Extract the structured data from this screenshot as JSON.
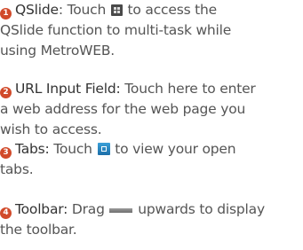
{
  "items": [
    {
      "number": "1",
      "term": "QSlide",
      "sep": ":",
      "text_before_icon": " Touch ",
      "icon": "qslide-icon",
      "line1_after_icon": " to access the",
      "line2": "QSlide function to multi-task while",
      "line3": "using MetroWEB."
    },
    {
      "number": "2",
      "term": "URL Input Field:",
      "line1_text": " Touch here to enter",
      "line2": "a web address for the web page you",
      "line3": "wish to access."
    },
    {
      "number": "3",
      "term": "Tabs:",
      "text_before_icon": " Touch ",
      "icon": "tabs-icon",
      "line1_after_icon": " to view your open",
      "line2": "tabs."
    },
    {
      "number": "4",
      "term": "Toolbar:",
      "text_before_icon": " Drag ",
      "icon": "drag-handle-icon",
      "line1_after_icon": " upwards to display",
      "line2": "the toolbar."
    }
  ],
  "colors": {
    "number_badge": "#d14a2a",
    "body_text": "#555555",
    "term_text": "#333333"
  }
}
